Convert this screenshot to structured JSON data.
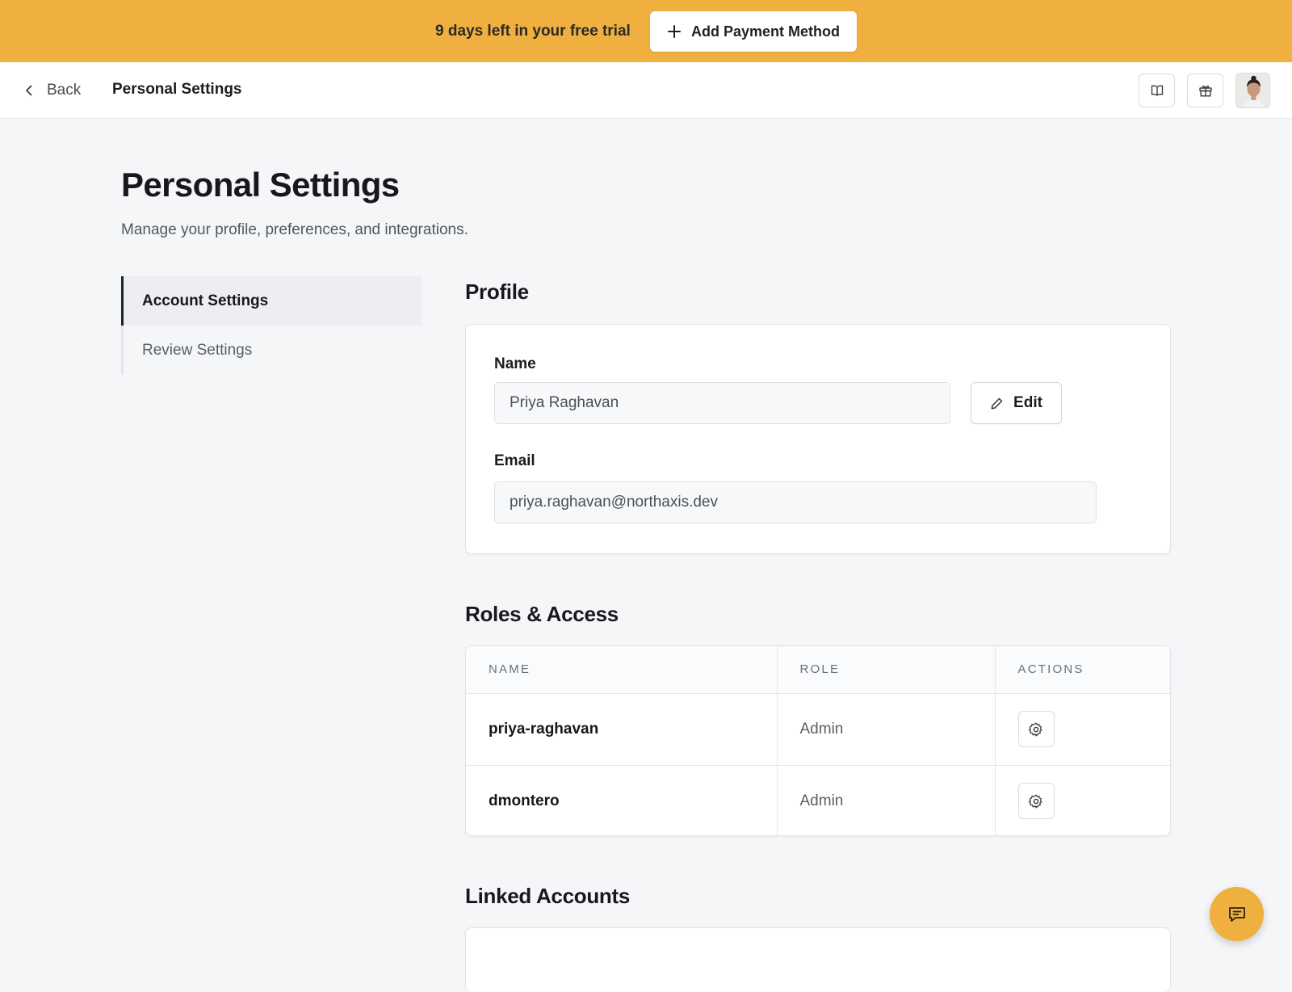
{
  "banner": {
    "text": "9 days left in your free trial",
    "button_label": "Add Payment Method"
  },
  "topnav": {
    "back_label": "Back",
    "title": "Personal Settings",
    "icons": [
      "book-icon",
      "gift-icon"
    ]
  },
  "page": {
    "title": "Personal Settings",
    "subtitle": "Manage your profile, preferences, and integrations."
  },
  "sidemenu": {
    "items": [
      {
        "label": "Account Settings",
        "active": true
      },
      {
        "label": "Review Settings",
        "active": false
      }
    ]
  },
  "profile": {
    "heading": "Profile",
    "name_label": "Name",
    "name_value": "Priya Raghavan",
    "edit_label": "Edit",
    "email_label": "Email",
    "email_value": "priya.raghavan@northaxis.dev"
  },
  "roles": {
    "heading": "Roles & Access",
    "columns": [
      "NAME",
      "ROLE",
      "ACTIONS"
    ],
    "rows": [
      {
        "name": "priya-raghavan",
        "role": "Admin"
      },
      {
        "name": "dmontero",
        "role": "Admin"
      }
    ]
  },
  "linked": {
    "heading": "Linked Accounts"
  },
  "colors": {
    "accent": "#efb03f",
    "background": "#f4f6f8"
  }
}
